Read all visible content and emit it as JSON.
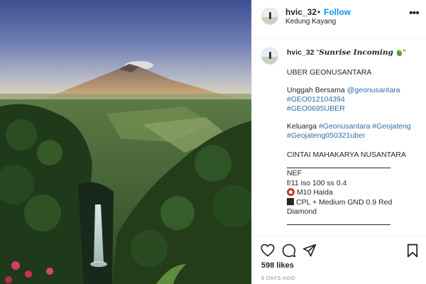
{
  "post": {
    "username": "hvic_32",
    "separator": "•",
    "follow_label": "Follow",
    "location": "Kedung Kayang",
    "more_label": "•••",
    "photo_alt": "mountain-waterfall-photo"
  },
  "caption": {
    "username": "hvic_32",
    "title": "\"Sunrise Incoming 🦜\"",
    "title_open": "\"",
    "title_text": "Sunrise Incoming",
    "title_close": "\"",
    "line1": "UBER GEONUSANTARA",
    "line2_prefix": "Unggah Bersama ",
    "mention": "@geonusantara",
    "tag1": "#GEO012104394",
    "tag2": "#GEO0695UBER",
    "line5_prefix": "Keluarga ",
    "tag3": "#Geonusantara",
    "tag4": "#Geojateng",
    "tag5": "#Geojateng050321uber",
    "line6": "CINTAI MAHAKARYA NUSANTARA",
    "gear1": "NEF",
    "gear2": "f/11 iso 100 ss 0.4",
    "gear3": "M10 Haida",
    "gear4a": "CPL + Medium GND 0.9 Red",
    "gear4b": "Diamond"
  },
  "stats": {
    "likes": "598 likes",
    "time_ago": "6 DAYS AGO"
  },
  "colors": {
    "link": "#2f6da8",
    "follow": "#0095f6",
    "secondary_text": "#8e8e8e"
  },
  "icons": [
    "more-options-icon",
    "heart-icon",
    "comment-icon",
    "share-icon",
    "bookmark-icon",
    "ring-filter-icon",
    "square-filter-icon",
    "parrot-emoji-icon"
  ]
}
